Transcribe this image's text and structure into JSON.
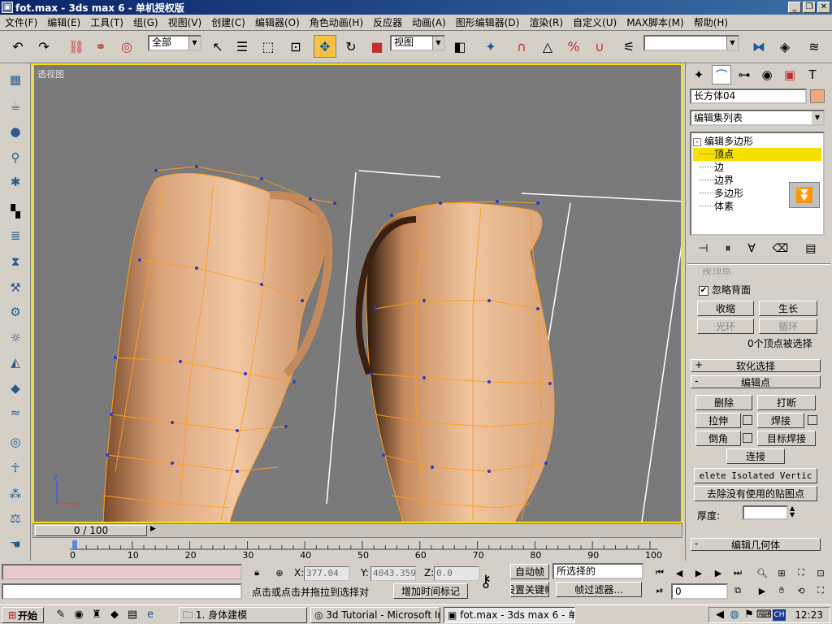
{
  "window": {
    "title": "fot.max - 3ds max 6 - 单机授权版",
    "minimize_label": "_",
    "restore_label": "❐",
    "close_label": "✕"
  },
  "menu": [
    "文件(F)",
    "编辑(E)",
    "工具(T)",
    "组(G)",
    "视图(V)",
    "创建(C)",
    "编辑器(O)",
    "角色动画(H)",
    "反应器",
    "动画(A)",
    "图形编辑器(D)",
    "渲染(R)",
    "自定义(U)",
    "MAX脚本(M)",
    "帮助(H)"
  ],
  "toolbar": {
    "selection_filter": "全部",
    "ref_coord": "视图",
    "named_selection": ""
  },
  "viewport": {
    "label": "透视图",
    "border_color": "#f5e000",
    "background": "#7a7a7a"
  },
  "command_panel": {
    "object_name": "长方体04",
    "object_color": "#f5a87a",
    "modifier_list": "编辑集列表",
    "stack": {
      "modifier": "编辑多边形",
      "expand_sign": "-",
      "subobjects": [
        "顶点",
        "边",
        "边界",
        "多边形",
        "体素"
      ],
      "selected": "顶点"
    },
    "selection": {
      "partial_label": "按顶点",
      "ignore_backfacing": "忽略背面",
      "ignore_backfacing_checked": true,
      "shrink": "收缩",
      "grow": "生长",
      "ring": "光环",
      "loop": "循环",
      "status": "0个顶点被选择"
    },
    "soft_selection": {
      "sign": "+",
      "label": "软化选择"
    },
    "edit_vertices": {
      "sign": "-",
      "label": "编辑点",
      "remove": "删除",
      "break": "打断",
      "extrude": "拉伸",
      "weld": "焊接",
      "chamfer": "倒角",
      "target_weld": "目标焊接",
      "connect": "连接",
      "remove_isolated": "elete Isolated Vertic",
      "remove_unused_map": "去除没有使用的贴图点",
      "weight_label": "厚度:",
      "weight_value": ""
    },
    "edit_geometry": {
      "sign": "-",
      "label": "编辑几何体"
    }
  },
  "timeline": {
    "slider_label": "0 / 100",
    "ticks": [
      "0",
      "10",
      "20",
      "30",
      "40",
      "50",
      "60",
      "70",
      "80",
      "90",
      "100"
    ]
  },
  "status": {
    "x_label": "X:",
    "x_value": "377.04",
    "y_label": "Y:",
    "y_value": "4043.359",
    "z_label": "Z:",
    "z_value": "0.0",
    "prompt": "点击或点击并拖拉到选择对",
    "add_time_tag": "增加时间标记",
    "auto_key": "自动帧",
    "set_key": "设置关键帧",
    "key_filter_value": "所选择的",
    "key_filters": "帧过滤器...",
    "current_frame": "0"
  },
  "taskbar": {
    "start": "开始",
    "tasks": [
      "1. 身体建模",
      "3d Tutorial - Microsoft Int...",
      "fot.max - 3ds max 6 - 单..."
    ],
    "lang": "CH",
    "clock": "12:23"
  }
}
